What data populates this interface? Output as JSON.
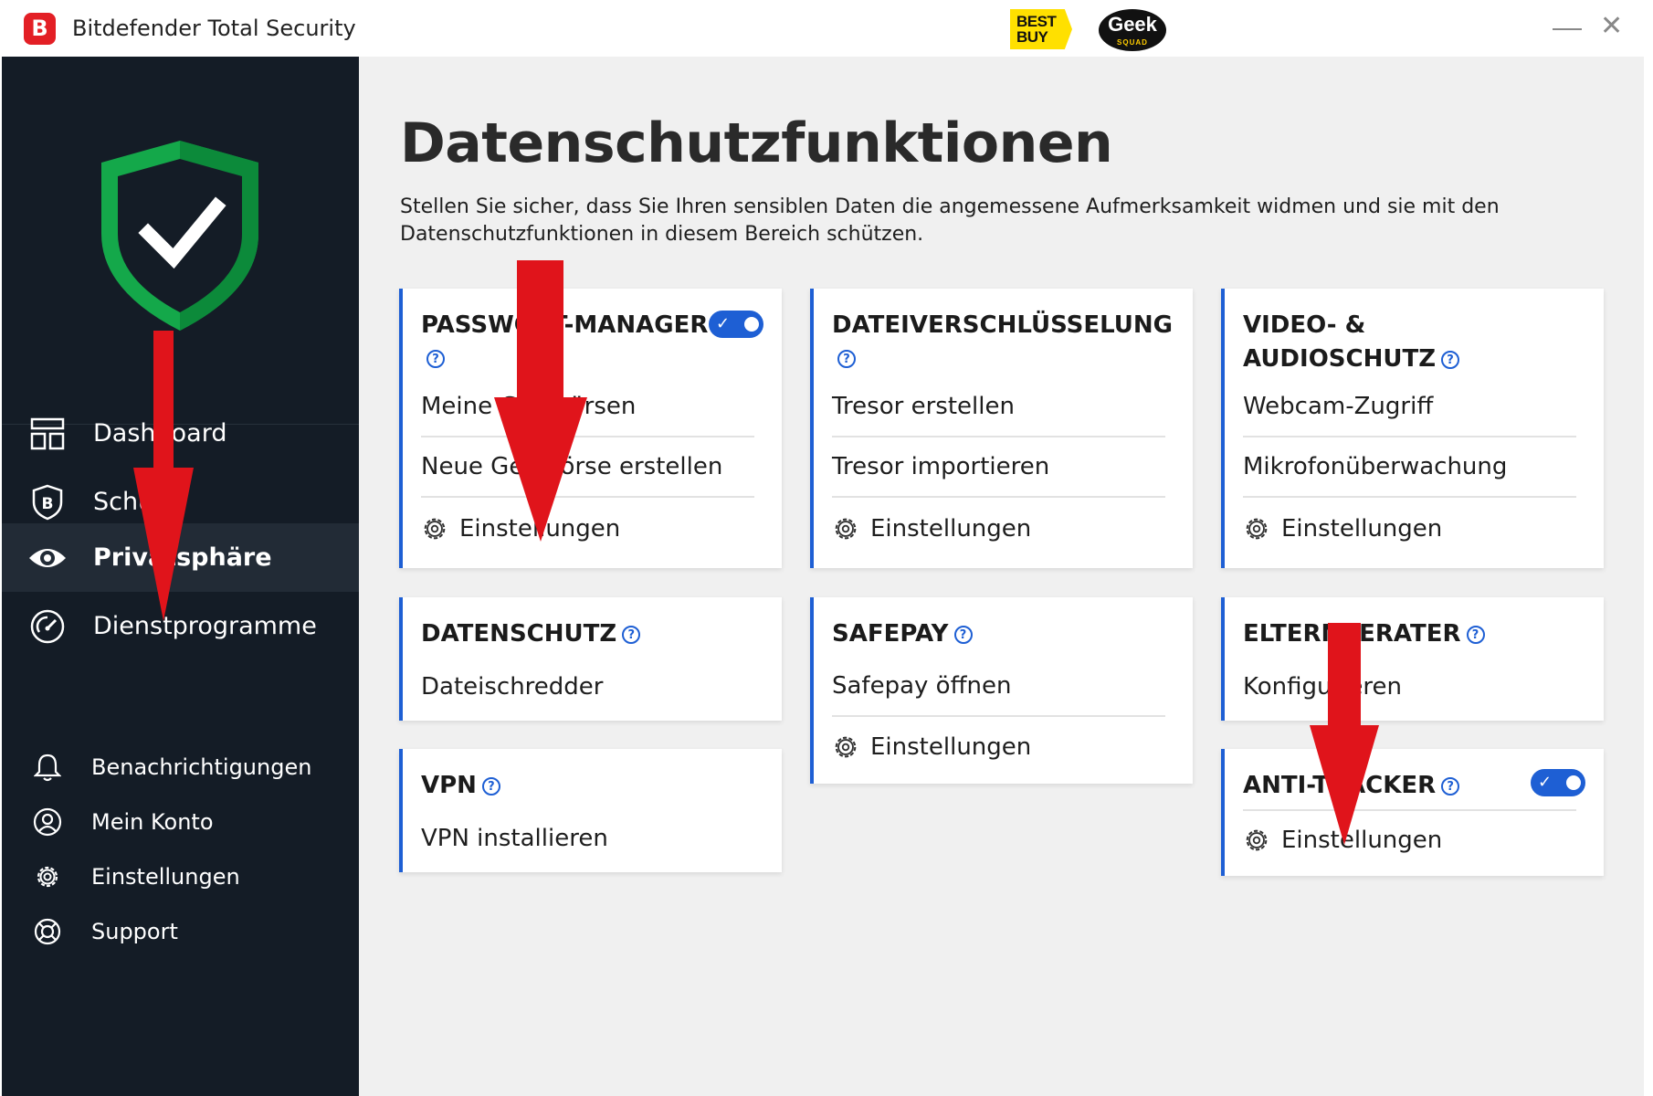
{
  "window": {
    "title": "Bitdefender Total Security",
    "logo_letter": "B",
    "badges": {
      "bestbuy": "BEST BUY",
      "geeksquad": "Geek",
      "geeksquad_sub": "SQUAD"
    },
    "close_glyph": "✕"
  },
  "sidebar": {
    "items": [
      {
        "label": "Dashboard",
        "icon": "dashboard-icon"
      },
      {
        "label": "Schutz",
        "icon": "shield-b-icon"
      },
      {
        "label": "Privatsphäre",
        "icon": "eye-icon",
        "active": true
      },
      {
        "label": "Dienstprogramme",
        "icon": "gauge-icon"
      }
    ],
    "bottom": [
      {
        "label": "Benachrichtigungen",
        "icon": "bell-icon"
      },
      {
        "label": "Mein Konto",
        "icon": "user-icon"
      },
      {
        "label": "Einstellungen",
        "icon": "gear-icon"
      },
      {
        "label": "Support",
        "icon": "lifebuoy-icon"
      }
    ]
  },
  "main": {
    "title": "Datenschutzfunktionen",
    "description": "Stellen Sie sicher, dass Sie Ihren sensiblen Daten die angemessene Aufmerksamkeit widmen und sie mit den Datenschutzfunktionen in diesem Bereich schützen.",
    "help_glyph": "?",
    "toggle_check": "✓",
    "cards": {
      "password_manager": {
        "title": "PASSWORT-MANAGER",
        "rows": [
          "Meine Geldbörsen",
          "Neue Geldbörse erstellen",
          "Einstellungen"
        ],
        "toggle_on": true
      },
      "file_encryption": {
        "title": "DATEIVERSCHLÜSSELUNG",
        "rows": [
          "Tresor erstellen",
          "Tresor importieren",
          "Einstellungen"
        ]
      },
      "video_audio": {
        "title_line1": "VIDEO- &",
        "title_line2": "AUDIOSCHUTZ",
        "rows": [
          "Webcam-Zugriff",
          "Mikrofonüberwachung",
          "Einstellungen"
        ]
      },
      "privacy": {
        "title": "DATENSCHUTZ",
        "rows": [
          "Dateischredder"
        ]
      },
      "safepay": {
        "title": "SAFEPAY",
        "rows": [
          "Safepay öffnen",
          "Einstellungen"
        ]
      },
      "parental": {
        "title": "ELTERNBERATER",
        "rows": [
          "Konfigurieren"
        ]
      },
      "vpn": {
        "title": "VPN",
        "rows": [
          "VPN installieren"
        ]
      },
      "anti_tracker": {
        "title": "ANTI-TRACKER",
        "rows": [
          "Einstellungen"
        ],
        "toggle_on": true
      }
    }
  },
  "colors": {
    "accent": "#1e5fd4",
    "sidebar_bg": "#141c26",
    "shield_green": "#1faa46",
    "annotation_arrow": "#e0141b"
  }
}
